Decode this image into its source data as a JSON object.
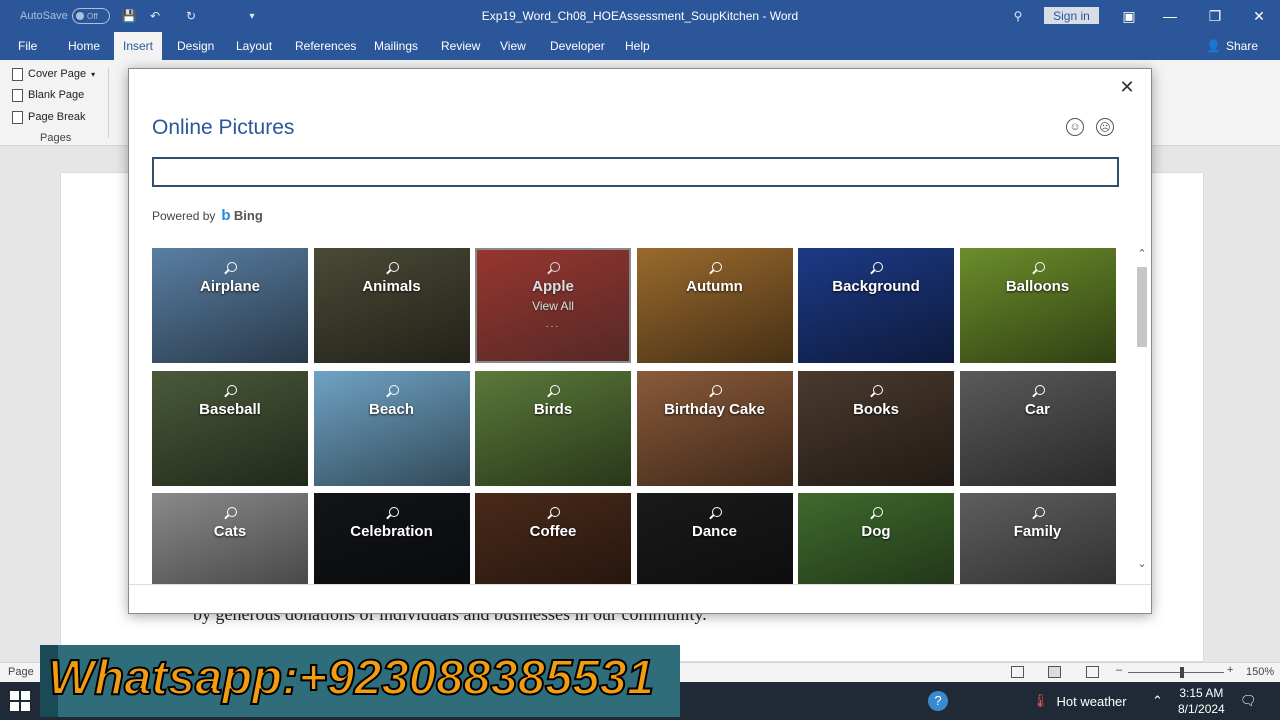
{
  "window": {
    "autosave_label": "AutoSave",
    "autosave_state": "Off",
    "doc_title": "Exp19_Word_Ch08_HOEAssessment_SoupKitchen",
    "app_sep": "-",
    "app_name": "Word",
    "signin_label": "Sign in"
  },
  "menu": {
    "tabs": [
      "File",
      "Home",
      "Insert",
      "Design",
      "Layout",
      "References",
      "Mailings",
      "Review",
      "View",
      "Developer",
      "Help"
    ],
    "active": "Insert",
    "share_label": "Share"
  },
  "ribbon": {
    "items": [
      "Cover Page",
      "Blank Page",
      "Page Break"
    ],
    "group_label": "Pages"
  },
  "document": {
    "visible_text": "by generous donations of individuals and businesses in our community."
  },
  "status": {
    "page_label": "Page",
    "zoom": "150%"
  },
  "taskbar": {
    "weather": "Hot weather",
    "time": "3:15 AM",
    "date": "8/1/2024"
  },
  "overlay": {
    "banner_text": "Whatsapp:+923088385531"
  },
  "dialog": {
    "title": "Online Pictures",
    "search_value": "",
    "powered_by": "Powered by",
    "provider": "Bing",
    "close_icon": "close-icon",
    "tiles": [
      {
        "label": "Airplane",
        "bg": "#5a7fa3"
      },
      {
        "label": "Animals",
        "bg": "#4b4a36"
      },
      {
        "label": "Apple",
        "bg": "#a32018",
        "sub": "View All",
        "dots": "...",
        "selected": true
      },
      {
        "label": "Autumn",
        "bg": "#9a6a2e"
      },
      {
        "label": "Background",
        "bg": "#1d3a86"
      },
      {
        "label": "Balloons",
        "bg": "#6b8e2b"
      },
      {
        "label": "Baseball",
        "bg": "#4a5a3a"
      },
      {
        "label": "Beach",
        "bg": "#6fa3c4"
      },
      {
        "label": "Birds",
        "bg": "#5a7a3a"
      },
      {
        "label": "Birthday Cake",
        "bg": "#8a5a3a"
      },
      {
        "label": "Books",
        "bg": "#4a3a2e"
      },
      {
        "label": "Car",
        "bg": "#5a5a5a"
      },
      {
        "label": "Cats",
        "bg": "#8a8a8a"
      },
      {
        "label": "Celebration",
        "bg": "#121418"
      },
      {
        "label": "Coffee",
        "bg": "#4a2a1a"
      },
      {
        "label": "Dance",
        "bg": "#1a1a1a"
      },
      {
        "label": "Dog",
        "bg": "#3f6a2e"
      },
      {
        "label": "Family",
        "bg": "#5e5e5e"
      }
    ]
  }
}
